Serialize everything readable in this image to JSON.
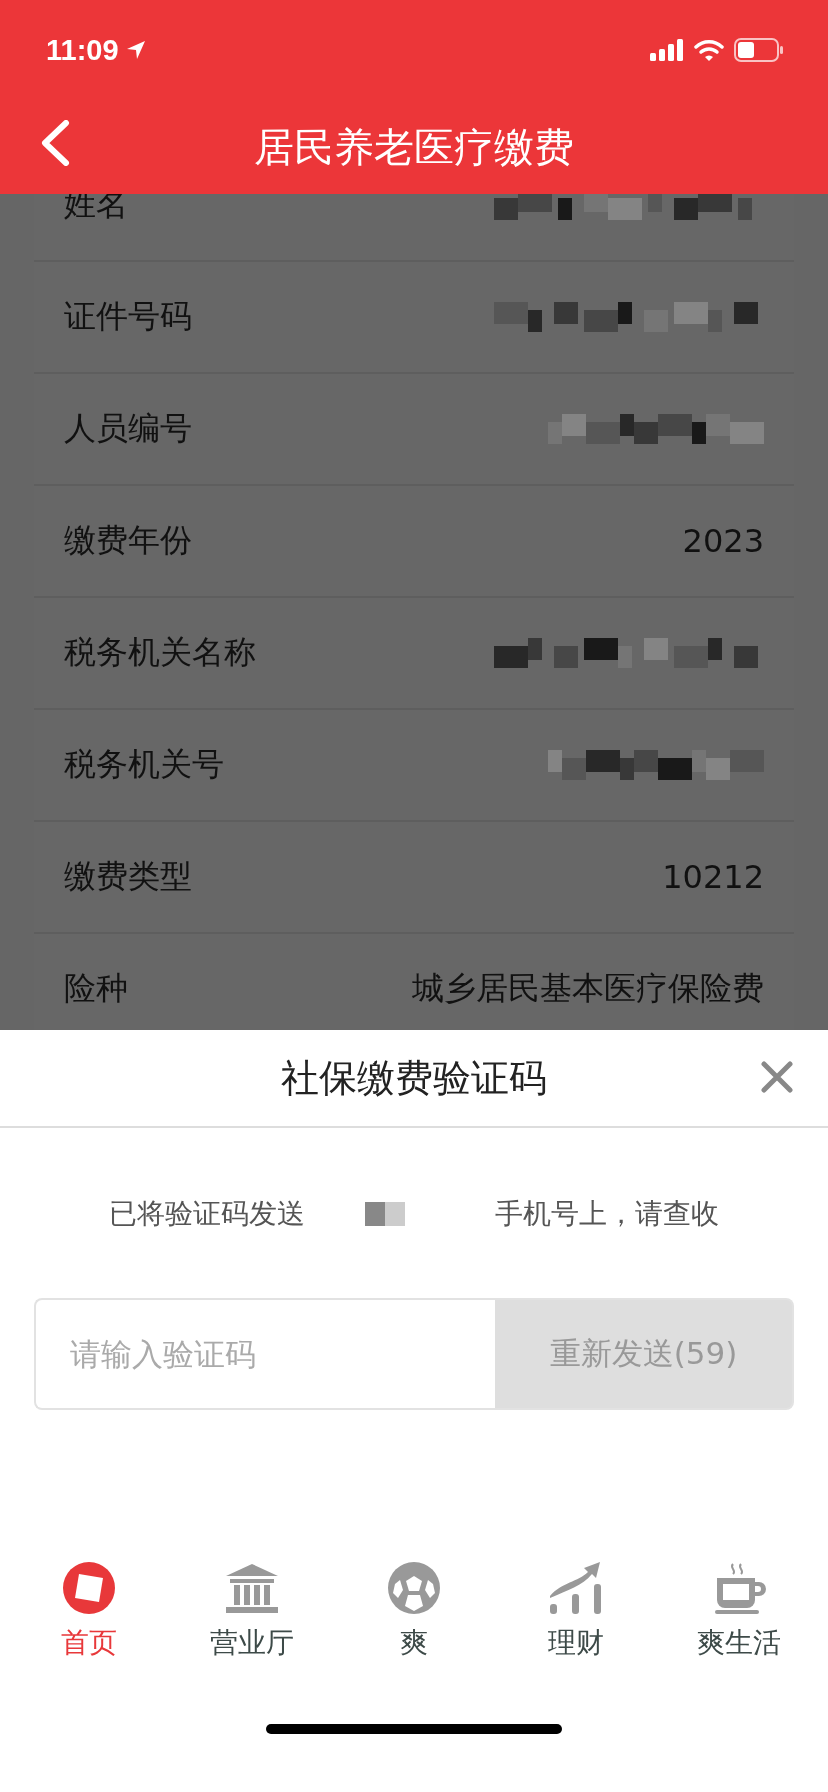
{
  "status_bar": {
    "time": "11:09"
  },
  "nav": {
    "title": "居民养老医疗缴费"
  },
  "fields": [
    {
      "label": "姓名",
      "redacted": true
    },
    {
      "label": "证件号码",
      "redacted": true
    },
    {
      "label": "人员编号",
      "redacted": true
    },
    {
      "label": "缴费年份",
      "value": "2023"
    },
    {
      "label": "税务机关名称",
      "redacted": true
    },
    {
      "label": "税务机关号",
      "redacted": true
    },
    {
      "label": "缴费类型",
      "value": "10212"
    },
    {
      "label": "险种",
      "value": "城乡居民基本医疗保险费"
    }
  ],
  "dialog": {
    "title": "社保缴费验证码",
    "message_before": "已将验证码发送",
    "message_after": "手机号上，请查收",
    "input": {
      "placeholder": "请输入验证码"
    },
    "resend_button": {
      "label": "重新发送(59)",
      "disabled": true
    }
  },
  "tab_bar": [
    {
      "label": "首页",
      "selected": true
    },
    {
      "label": "营业厅",
      "selected": false
    },
    {
      "label": "爽",
      "selected": false
    },
    {
      "label": "理财",
      "selected": false
    },
    {
      "label": "爽生活",
      "selected": false
    }
  ]
}
